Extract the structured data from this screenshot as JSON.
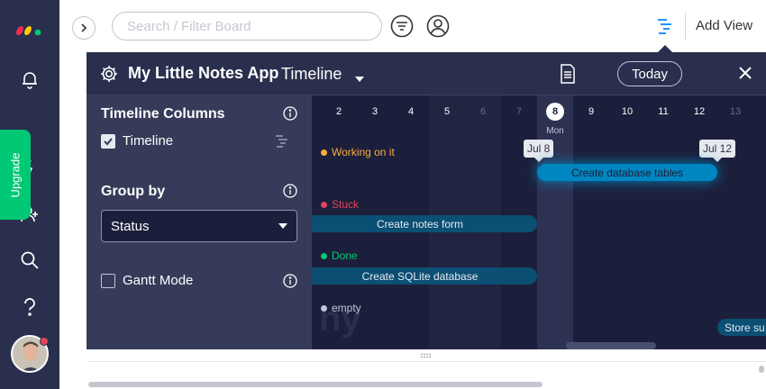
{
  "search": {
    "placeholder": "Search / Filter Board"
  },
  "topbar": {
    "add_view": "Add View"
  },
  "rail": {
    "upgrade": "Upgrade"
  },
  "board": {
    "title": "My Little Notes App",
    "view": "Timeline",
    "today": "Today"
  },
  "panel": {
    "timeline_columns": "Timeline Columns",
    "timeline_option": "Timeline",
    "group_by": "Group by",
    "group_by_value": "Status",
    "gantt_mode": "Gantt Mode"
  },
  "timeline": {
    "days": [
      "2",
      "3",
      "4",
      "5",
      "6",
      "7",
      "8",
      "9",
      "10",
      "11",
      "12",
      "13"
    ],
    "today_day": "8",
    "today_label": "Mon",
    "watermark": "ny",
    "groups": [
      {
        "label": "Working on it",
        "color": "#fdab3d"
      },
      {
        "label": "Stuck",
        "color": "#e2445c"
      },
      {
        "label": "Done",
        "color": "#00c875"
      },
      {
        "label": "empty",
        "color": "#c3c6d4"
      }
    ],
    "bars": [
      {
        "label": "Create database tables",
        "color": "#0086c0"
      },
      {
        "label": "Create notes form",
        "color": "#0b4f74"
      },
      {
        "label": "Create SQLite database",
        "color": "#0b4f74"
      },
      {
        "label": "Store su",
        "color": "#0b4f74"
      }
    ],
    "date_tags": [
      "Jul 8",
      "Jul 12"
    ]
  },
  "colors": {
    "rail": "#292f4c",
    "board": "#1c1f3b",
    "panel": "#363b5a",
    "upgrade": "#00c875",
    "accent": "#0073ea"
  }
}
